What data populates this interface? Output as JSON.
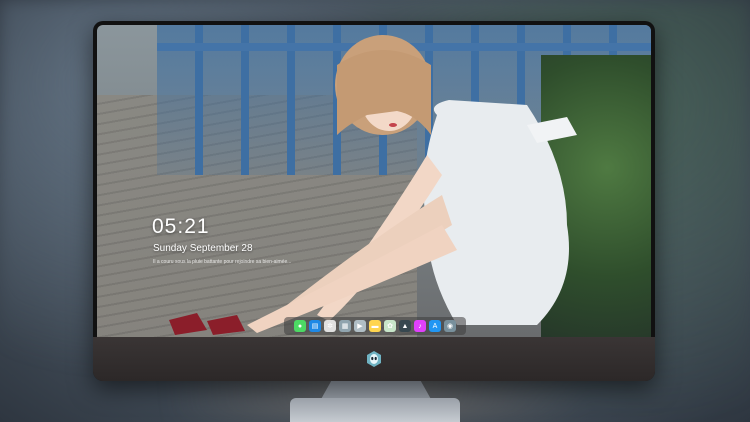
{
  "lock_screen": {
    "time": "05:21",
    "date": "Sunday September  28",
    "quote": "Il a couru sous la pluie battante pour rejoindre sa bien-aimée..."
  },
  "dock": {
    "apps": [
      {
        "name": "messages",
        "icon": "message-bubble-icon",
        "color": "#4cd964",
        "glyph": "●"
      },
      {
        "name": "finder",
        "icon": "folder-icon",
        "color": "#1e88e5",
        "glyph": "▤"
      },
      {
        "name": "safari",
        "icon": "compass-icon",
        "color": "#e0e0e0",
        "glyph": "✲"
      },
      {
        "name": "preview",
        "icon": "image-icon",
        "color": "#90a4ae",
        "glyph": "▦"
      },
      {
        "name": "clapper",
        "icon": "video-icon",
        "color": "#b0bec5",
        "glyph": "▶"
      },
      {
        "name": "notes",
        "icon": "notes-icon",
        "color": "#ffd54f",
        "glyph": "▬"
      },
      {
        "name": "photos",
        "icon": "photos-icon",
        "color": "#c8e6c9",
        "glyph": "✿"
      },
      {
        "name": "launcher",
        "icon": "bird-icon",
        "color": "#37474f",
        "glyph": "▲"
      },
      {
        "name": "music",
        "icon": "music-icon",
        "color": "#e040fb",
        "glyph": "♪"
      },
      {
        "name": "app-store",
        "icon": "app-store-icon",
        "color": "#2196f3",
        "glyph": "A"
      },
      {
        "name": "camera",
        "icon": "camera-icon",
        "color": "#78909c",
        "glyph": "◉"
      }
    ]
  },
  "colors": {
    "accent_blue": "#4474a8",
    "chin": "#2c2828"
  }
}
